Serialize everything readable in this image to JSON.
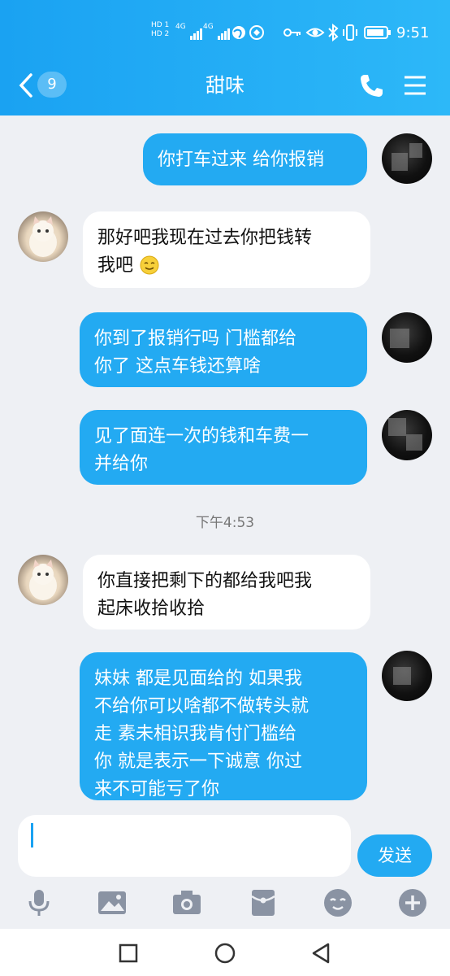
{
  "status_bar": {
    "time": "9:51",
    "hd1": "HD 1",
    "hd2": "HD 2",
    "net1": "4G",
    "net2": "4G"
  },
  "header": {
    "back_badge": "9",
    "title": "甜味"
  },
  "messages": [
    {
      "side": "out",
      "text": "你打车过来 给你报销"
    },
    {
      "side": "in",
      "text": "那好吧我现在过去你把钱转\n我吧"
    },
    {
      "side": "out",
      "text": "你到了报销行吗 门槛都给\n你了 这点车钱还算啥"
    },
    {
      "side": "out",
      "text": "见了面连一次的钱和车费一\n并给你"
    },
    {
      "side": "in",
      "text": "你直接把剩下的都给我吧我\n起床收拾收拾"
    },
    {
      "side": "out",
      "text": "妹妹 都是见面给的 如果我\n不给你可以啥都不做转头就\n走 素未相识我肯付门槛给\n你 就是表示一下诚意 你过\n来不可能亏了你"
    }
  ],
  "timestamp": "下午4:53",
  "input": {
    "value": "",
    "send_label": "发送"
  },
  "toolbar": [
    "mic-icon",
    "image-icon",
    "camera-icon",
    "red-packet-icon",
    "emoji-icon",
    "plus-icon"
  ],
  "colors": {
    "header": "#1aa2f2",
    "bubble_out": "#23aaf2",
    "bubble_in": "#ffffff",
    "background": "#eef0f4"
  }
}
